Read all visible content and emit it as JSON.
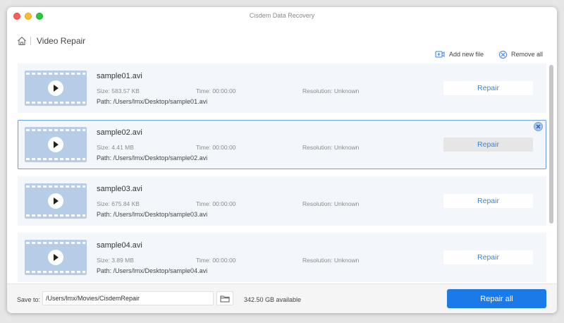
{
  "window": {
    "title": "Cisdem Data Recovery"
  },
  "header": {
    "page_title": "Video Repair"
  },
  "actions": {
    "add_new_file": "Add new file",
    "remove_all": "Remove all"
  },
  "labels": {
    "size": "Size:",
    "time": "Time:",
    "resolution": "Resolution:",
    "path": "Path:"
  },
  "files": [
    {
      "name": "sample01.avi",
      "size": "583.57 KB",
      "time": "00:00:00",
      "resolution": "Unknown",
      "path": "/Users/lmx/Desktop/sample01.avi",
      "repair_label": "Repair"
    },
    {
      "name": "sample02.avi",
      "size": "4.41 MB",
      "time": "00:00:00",
      "resolution": "Unknown",
      "path": "/Users/lmx/Desktop/sample02.avi",
      "repair_label": "Repair"
    },
    {
      "name": "sample03.avi",
      "size": "675.84 KB",
      "time": "00:00:00",
      "resolution": "Unknown",
      "path": "/Users/lmx/Desktop/sample03.avi",
      "repair_label": "Repair"
    },
    {
      "name": "sample04.avi",
      "size": "3.89 MB",
      "time": "00:00:00",
      "resolution": "Unknown",
      "path": "/Users/lmx/Desktop/sample04.avi",
      "repair_label": "Repair"
    }
  ],
  "footer": {
    "save_to_label": "Save to:",
    "save_path": "/Users/lmx/Movies/CisdemRepair",
    "available": "342.50 GB available",
    "repair_all": "Repair all"
  },
  "colors": {
    "accent": "#1c7ae8",
    "link": "#3a82e8",
    "item_bg": "#f3f7fc",
    "thumb": "#b6cce7"
  },
  "icons": {
    "home": "home-icon",
    "add_file": "add-video-icon",
    "remove_all": "close-circle-icon",
    "play": "play-icon",
    "folder": "folder-icon"
  }
}
